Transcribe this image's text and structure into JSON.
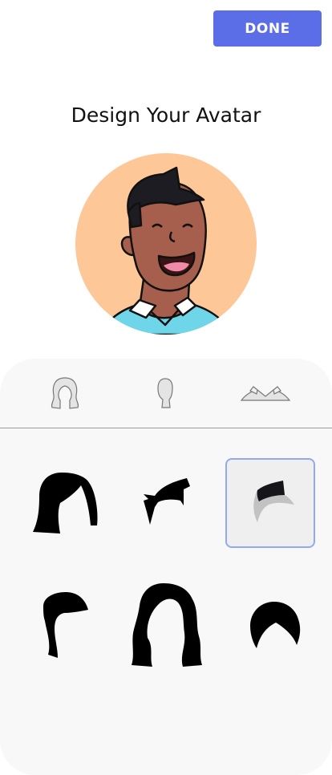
{
  "header": {
    "done_label": "DONE"
  },
  "title": "Design Your Avatar",
  "avatar": {
    "background_color": "#fdc797",
    "skin_color": "#a65f4d",
    "hair_color": "#1c1c22",
    "shirt_color": "#6fd6ea"
  },
  "tabs": [
    {
      "icon": "hair-icon"
    },
    {
      "icon": "head-icon"
    },
    {
      "icon": "shirt-collar-icon"
    }
  ],
  "hair_options": [
    {
      "icon": "hair-bob-bangs-icon",
      "selected": false
    },
    {
      "icon": "hair-spiky-icon",
      "selected": false
    },
    {
      "icon": "hair-mohawk-icon",
      "selected": true
    },
    {
      "icon": "hair-side-fringe-icon",
      "selected": false
    },
    {
      "icon": "hair-long-wavy-icon",
      "selected": false
    },
    {
      "icon": "hair-bowl-icon",
      "selected": false
    }
  ],
  "colors": {
    "accent": "#5b6ee8",
    "selected_border": "#93a9ee",
    "panel_bg": "#f8f8f8"
  }
}
